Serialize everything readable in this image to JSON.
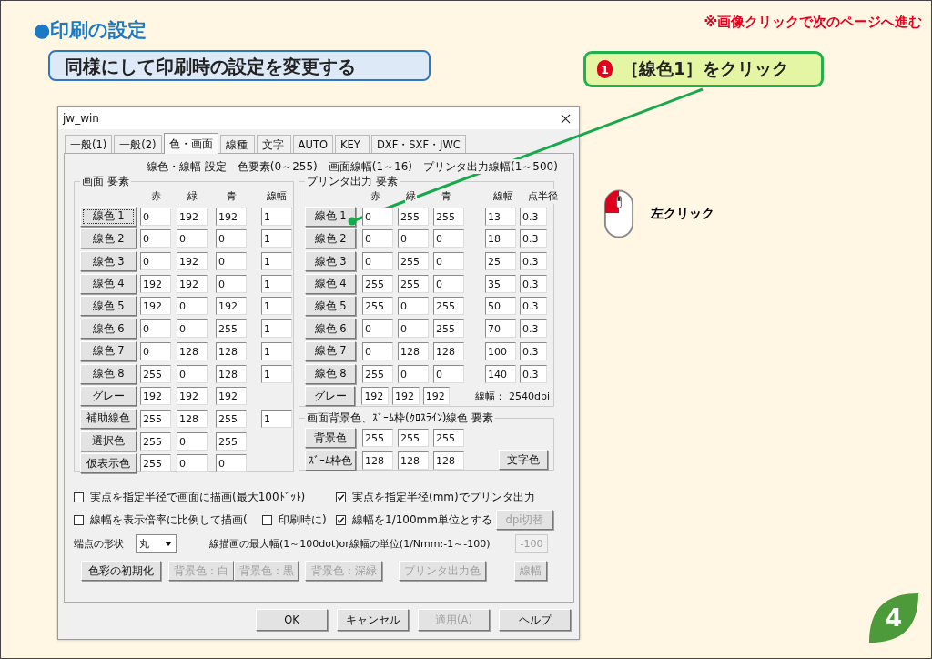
{
  "heading": "●印刷の設定",
  "notice": "※画像クリックで次のページへ進む",
  "instruction": "同様にして印刷時の設定を変更する",
  "step": {
    "number": "1",
    "label": "［線色1］をクリック"
  },
  "mouse_hint": "左クリック",
  "page_number": "4",
  "dialog": {
    "title": "jw_win",
    "tabs": [
      {
        "label": "一般(1)",
        "selected": false
      },
      {
        "label": "一般(2)",
        "selected": false
      },
      {
        "label": "色・画面",
        "selected": true
      },
      {
        "label": "線種",
        "selected": false
      },
      {
        "label": "文字",
        "selected": false
      },
      {
        "label": "AUTO",
        "selected": false
      },
      {
        "label": "KEY",
        "selected": false
      },
      {
        "label": "DXF・SXF・JWC",
        "selected": false
      }
    ],
    "caption": "線色・線幅 設定　色要素(0～255)　画面線幅(1～16)　プリンタ出力線幅(1～500)",
    "screen_group": {
      "title": "画面 要素",
      "columns": [
        "赤",
        "緑",
        "青",
        "線幅"
      ],
      "rows": [
        {
          "button": "線色 1",
          "focused": true,
          "values": [
            "0",
            "192",
            "192",
            "1"
          ]
        },
        {
          "button": "線色 2",
          "focused": false,
          "values": [
            "0",
            "0",
            "0",
            "1"
          ]
        },
        {
          "button": "線色 3",
          "focused": false,
          "values": [
            "0",
            "192",
            "0",
            "1"
          ]
        },
        {
          "button": "線色 4",
          "focused": false,
          "values": [
            "192",
            "192",
            "0",
            "1"
          ]
        },
        {
          "button": "線色 5",
          "focused": false,
          "values": [
            "192",
            "0",
            "192",
            "1"
          ]
        },
        {
          "button": "線色 6",
          "focused": false,
          "values": [
            "0",
            "0",
            "255",
            "1"
          ]
        },
        {
          "button": "線色 7",
          "focused": false,
          "values": [
            "0",
            "128",
            "128",
            "1"
          ]
        },
        {
          "button": "線色 8",
          "focused": false,
          "values": [
            "255",
            "0",
            "128",
            "1"
          ]
        },
        {
          "button": "グレー",
          "focused": false,
          "values": [
            "192",
            "192",
            "192"
          ]
        },
        {
          "button": "補助線色",
          "focused": false,
          "values": [
            "255",
            "128",
            "255",
            "1"
          ]
        },
        {
          "button": "選択色",
          "focused": false,
          "values": [
            "255",
            "0",
            "255"
          ]
        },
        {
          "button": "仮表示色",
          "focused": false,
          "values": [
            "255",
            "0",
            "0"
          ]
        }
      ]
    },
    "printer_group": {
      "title": "プリンタ出力 要素",
      "columns": [
        "赤",
        "緑",
        "青",
        "線幅",
        "点半径"
      ],
      "rows": [
        {
          "button": "線色 1",
          "values": [
            "0",
            "255",
            "255",
            "13",
            "0.3"
          ]
        },
        {
          "button": "線色 2",
          "values": [
            "0",
            "0",
            "0",
            "18",
            "0.3"
          ]
        },
        {
          "button": "線色 3",
          "values": [
            "0",
            "255",
            "0",
            "25",
            "0.3"
          ]
        },
        {
          "button": "線色 4",
          "values": [
            "255",
            "255",
            "0",
            "35",
            "0.3"
          ]
        },
        {
          "button": "線色 5",
          "values": [
            "255",
            "0",
            "255",
            "50",
            "0.3"
          ]
        },
        {
          "button": "線色 6",
          "values": [
            "0",
            "0",
            "255",
            "70",
            "0.3"
          ]
        },
        {
          "button": "線色 7",
          "values": [
            "0",
            "128",
            "128",
            "100",
            "0.3"
          ]
        },
        {
          "button": "線色 8",
          "values": [
            "255",
            "0",
            "0",
            "140",
            "0.3"
          ]
        }
      ],
      "gray_row": {
        "button": "グレー",
        "values": [
          "192",
          "192",
          "192"
        ],
        "note": "線幅： 2540dpi"
      }
    },
    "background_group": {
      "title": "画面背景色、ｽﾞｰﾑ枠(ｸﾛｽﾗｲﾝ)線色 要素",
      "rows": [
        {
          "button": "背景色",
          "values": [
            "255",
            "255",
            "255"
          ]
        },
        {
          "button": "ｽﾞｰﾑ枠色",
          "values": [
            "128",
            "128",
            "128"
          ]
        }
      ],
      "side_button": "文字色"
    },
    "options": [
      [
        {
          "kind": "checkbox",
          "label": "実点を指定半径で画面に描画(最大100ﾄﾞｯﾄ)",
          "checked": false
        },
        {
          "kind": "checkbox",
          "label": "実点を指定半径(mm)でプリンタ出力",
          "checked": true
        }
      ],
      [
        {
          "kind": "checkbox",
          "label": "線幅を表示倍率に比例して描画(",
          "checked": false
        },
        {
          "kind": "checkbox",
          "label": "印刷時に)",
          "checked": false
        },
        {
          "kind": "checkbox",
          "label": "線幅を1/100mm単位とする",
          "checked": true
        },
        {
          "kind": "button",
          "label": "dpi切替",
          "disabled": true
        }
      ],
      [
        {
          "kind": "label",
          "label": "端点の形状"
        },
        {
          "kind": "dropdown",
          "label": "丸"
        },
        {
          "kind": "label",
          "label": "線描画の最大幅(1～100dot)or線幅の単位(1/Nmm:-1～-100)"
        },
        {
          "kind": "field",
          "label": "-100",
          "disabled": true
        }
      ],
      [
        {
          "kind": "button",
          "label": "色彩の初期化",
          "disabled": false
        },
        {
          "kind": "button",
          "label": "背景色：白",
          "disabled": true
        },
        {
          "kind": "button",
          "label": "背景色：黒",
          "disabled": true
        },
        {
          "kind": "button",
          "label": "背景色：深緑",
          "disabled": true
        },
        {
          "kind": "button",
          "label": "プリンタ出力色",
          "disabled": true
        },
        {
          "kind": "button",
          "label": "線幅",
          "disabled": true
        }
      ]
    ],
    "footer_buttons": [
      {
        "label": "OK",
        "disabled": false
      },
      {
        "label": "キャンセル",
        "disabled": false
      },
      {
        "label": "適用(A)",
        "disabled": true
      },
      {
        "label": "ヘルプ",
        "disabled": false
      }
    ]
  }
}
